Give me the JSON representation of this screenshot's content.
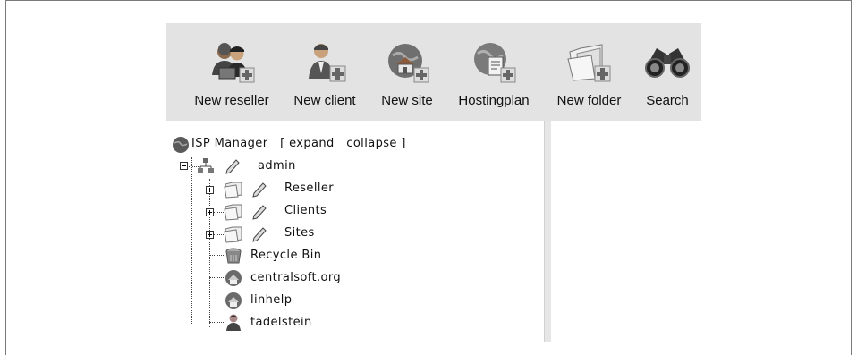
{
  "toolbar": {
    "items": [
      {
        "label": "New reseller",
        "icon": "new-reseller-icon"
      },
      {
        "label": "New client",
        "icon": "new-client-icon"
      },
      {
        "label": "New site",
        "icon": "new-site-icon"
      },
      {
        "label": "Hostingplan",
        "icon": "hostingplan-icon"
      },
      {
        "label": "New folder",
        "icon": "new-folder-icon"
      },
      {
        "label": "Search",
        "icon": "binoculars-icon"
      }
    ]
  },
  "tree": {
    "root": {
      "label": "ISP Manager",
      "bracket_open": "[",
      "expand": "expand",
      "collapse": "collapse",
      "bracket_close": "]"
    },
    "admin": {
      "label": "admin"
    },
    "folders": [
      {
        "label": "Reseller"
      },
      {
        "label": "Clients"
      },
      {
        "label": "Sites"
      }
    ],
    "leaves": [
      {
        "label": "Recycle Bin",
        "icon": "recycle-bin-icon"
      },
      {
        "label": "centralsoft.org",
        "icon": "site-globe-icon"
      },
      {
        "label": "linhelp",
        "icon": "site-globe-icon"
      },
      {
        "label": "tadelstein",
        "icon": "user-icon"
      }
    ]
  },
  "colors": {
    "toolbar_bg": "#e3e3e3",
    "panel_divider": "#e6e6e6"
  }
}
